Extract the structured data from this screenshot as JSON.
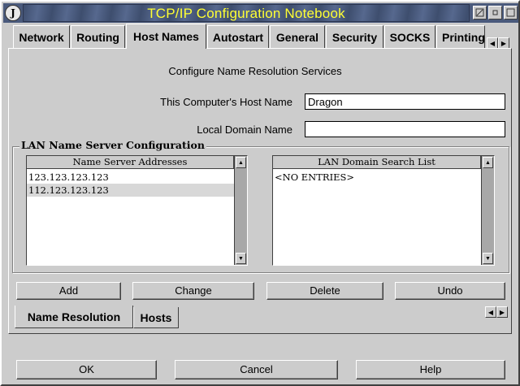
{
  "window": {
    "title": "TCP/IP Configuration Notebook",
    "system_menu_glyph": "J",
    "minimize_icon": "minimize-icon",
    "restore_icon": "restore-icon",
    "close_icon": "close-icon"
  },
  "major_tabs": [
    "Network",
    "Routing",
    "Host Names",
    "Autostart",
    "General",
    "Security",
    "SOCKS",
    "Printing"
  ],
  "active_major_tab": "Host Names",
  "page": {
    "heading": "Configure Name Resolution Services",
    "host_name_label": "This Computer's Host Name",
    "host_name_value": "Dragon",
    "domain_name_label": "Local Domain Name",
    "domain_name_value": ""
  },
  "lan_group": {
    "title": "LAN Name Server Configuration",
    "name_servers": {
      "header": "Name Server Addresses",
      "rows": [
        "123.123.123.123",
        "112.123.123.123"
      ],
      "selected_index": 1
    },
    "search_list": {
      "header": "LAN Domain Search List",
      "rows": [
        "<NO ENTRIES>"
      ]
    }
  },
  "action_buttons": {
    "add": "Add",
    "change": "Change",
    "delete": "Delete",
    "undo": "Undo"
  },
  "minor_tabs": [
    "Name Resolution",
    "Hosts"
  ],
  "active_minor_tab": "Name Resolution",
  "dialog_buttons": {
    "ok": "OK",
    "cancel": "Cancel",
    "help": "Help"
  },
  "colors": {
    "title_text": "#ffff33",
    "title_bar": "#4a5a7c",
    "background": "#cccccc"
  }
}
